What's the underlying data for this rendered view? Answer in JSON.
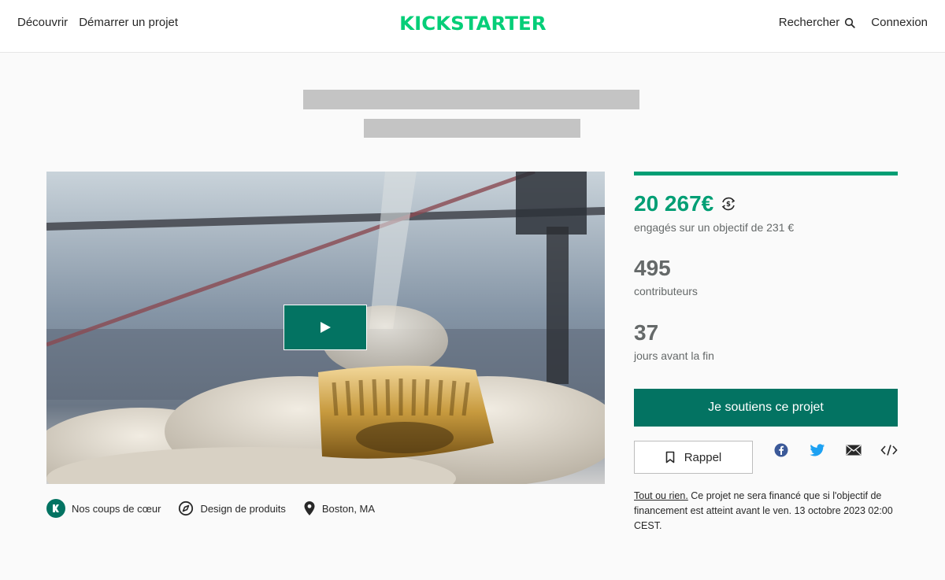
{
  "header": {
    "nav_discover": "Découvrir",
    "nav_start": "Démarrer un projet",
    "logo_text": "KICKSTARTER",
    "search_label": "Rechercher",
    "login_label": "Connexion"
  },
  "project": {
    "video": {
      "play_icon": "play-icon"
    },
    "meta": {
      "pwl_label": "Nos coups de cœur",
      "category_label": "Design de produits",
      "location_label": "Boston, MA"
    }
  },
  "campaign": {
    "progress_percent": 100,
    "pledged_amount": "20 267€",
    "pledged_sub": "engagés sur un objectif de 231 €",
    "backers_count": "495",
    "backers_label": "contributeurs",
    "days_count": "37",
    "days_label": "jours avant la fin",
    "back_button": "Je soutiens ce projet",
    "remind_button": "Rappel",
    "aon_link": "Tout ou rien.",
    "aon_text": " Ce projet ne sera financé que si l'objectif de financement est atteint avant le ven. 13 octobre 2023 02:00 CEST."
  },
  "colors": {
    "brand_green": "#05ce78",
    "accent_teal": "#037362",
    "pledged_green": "#009e74",
    "muted_text": "#656969"
  }
}
